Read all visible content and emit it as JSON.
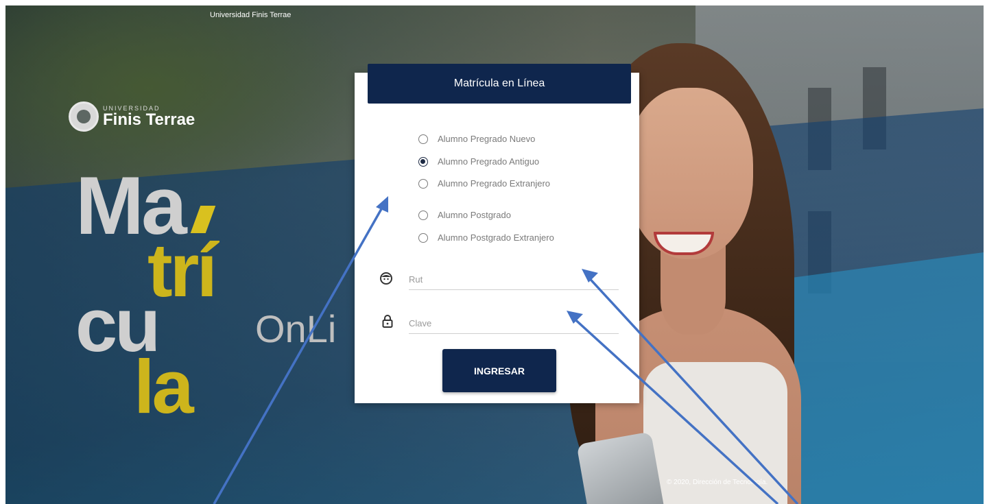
{
  "header": {
    "university": "Universidad Finis Terrae"
  },
  "logo": {
    "small": "UNIVERSIDAD",
    "big": "Finis Terrae"
  },
  "hero": {
    "line1": "Ma",
    "line2": "trí",
    "line3": "cu",
    "line4": "la",
    "online": "OnLi"
  },
  "card": {
    "title": "Matrícula en Línea",
    "options": [
      {
        "label": "Alumno Pregrado Nuevo",
        "checked": false
      },
      {
        "label": "Alumno Pregrado Antiguo",
        "checked": true
      },
      {
        "label": "Alumno Pregrado Extranjero",
        "checked": false
      },
      {
        "label": "Alumno Postgrado",
        "checked": false
      },
      {
        "label": "Alumno Postgrado Extranjero",
        "checked": false
      }
    ],
    "rut_placeholder": "Rut",
    "clave_placeholder": "Clave",
    "submit_label": "INGRESAR"
  },
  "footer": {
    "text": "© 2020, Dirección de Tecnología."
  },
  "colors": {
    "primary": "#0f264d",
    "accent_yellow": "#cdb51c",
    "annotation_arrow": "#4472c4"
  },
  "icons": {
    "rut": "face-icon",
    "clave": "lock-icon"
  }
}
